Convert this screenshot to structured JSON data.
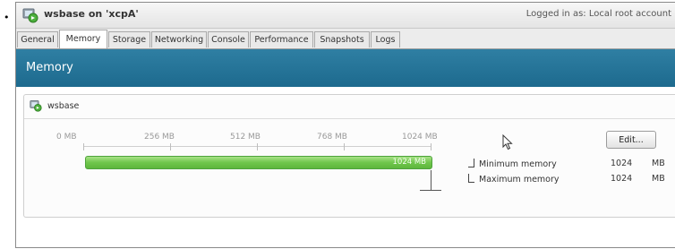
{
  "bullet": "•",
  "window": {
    "title": "wsbase on 'xcpA'",
    "login_info": "Logged in as: Local root account"
  },
  "tabs": [
    {
      "label": "General",
      "active": false
    },
    {
      "label": "Memory",
      "active": true
    },
    {
      "label": "Storage",
      "active": false
    },
    {
      "label": "Networking",
      "active": false
    },
    {
      "label": "Console",
      "active": false
    },
    {
      "label": "Performance",
      "active": false
    },
    {
      "label": "Snapshots",
      "active": false
    },
    {
      "label": "Logs",
      "active": false
    }
  ],
  "banner": {
    "title": "Memory"
  },
  "panel": {
    "vm_name": "wsbase",
    "scale_labels": [
      "0 MB",
      "256 MB",
      "512 MB",
      "768 MB",
      "1024 MB"
    ],
    "bar": {
      "label": "1024 MB",
      "value_mb": 1024,
      "max_mb": 1024
    },
    "edit_label": "Edit...",
    "legend": [
      {
        "label": "Minimum memory",
        "value": "1024",
        "unit": "MB"
      },
      {
        "label": "Maximum memory",
        "value": "1024",
        "unit": "MB"
      }
    ]
  },
  "colors": {
    "banner": "#1d6a8e",
    "bar_fill": "#6fc64b",
    "icon_green": "#4caf3d"
  }
}
